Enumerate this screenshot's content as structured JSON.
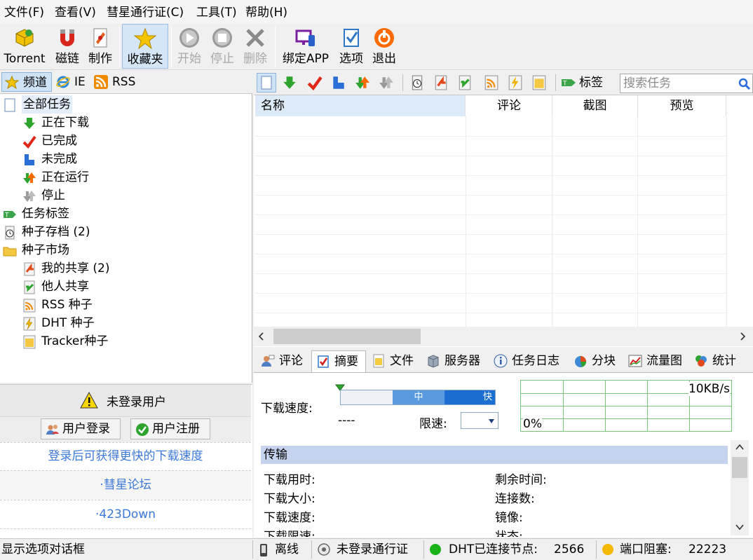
{
  "menubar": {
    "items": [
      "文件(F)",
      "查看(V)",
      "彗星通行证(C)",
      "工具(T)",
      "帮助(H)"
    ]
  },
  "toolbar": {
    "torrent": "Torrent",
    "magnet": "磁链",
    "create": "制作",
    "favorites": "收藏夹",
    "start": "开始",
    "stop": "停止",
    "delete": "删除",
    "bind_app": "绑定APP",
    "options": "选项",
    "exit": "退出"
  },
  "left_tabs": [
    "频道",
    "IE",
    "RSS"
  ],
  "tree": {
    "all_tasks": "全部任务",
    "downloading": "正在下载",
    "completed": "已完成",
    "incomplete": "未完成",
    "running": "正在运行",
    "stopped": "停止",
    "task_tags": "任务标签",
    "torrent_archive": "种子存档 (2)",
    "torrent_market": "种子市场",
    "my_shares": "我的共享 (2)",
    "others_shares": "他人共享",
    "rss_torrents": "RSS 种子",
    "dht_torrents": "DHT 种子",
    "tracker_torrents": "Tracker种子"
  },
  "user_panel": {
    "title": "未登录用户",
    "login": "用户登录",
    "register": "用户注册",
    "hint": "登录后可获得更快的下载速度",
    "link1": "·彗星论坛",
    "link2": "·423Down"
  },
  "task_toolbar": {
    "tags_label": "标签",
    "search_placeholder": "搜索任务"
  },
  "task_list": {
    "columns": [
      "名称",
      "评论",
      "截图",
      "预览"
    ]
  },
  "bottom_tabs": [
    "评论",
    "摘要",
    "文件",
    "服务器",
    "任务日志",
    "分块",
    "流量图",
    "统计"
  ],
  "summary": {
    "download_speed_label": "下载速度:",
    "speed_value": "----",
    "slider_mid": "中",
    "slider_fast": "快",
    "limit_label": "限速:",
    "graph_max": "10KB/s",
    "graph_pct": "0%",
    "section_title": "传输",
    "fields_left": [
      "下载用时:",
      "下载大小:",
      "下载速度:",
      "下载限速:"
    ],
    "fields_right": [
      "剩余时间:",
      "连接数:",
      "镜像:",
      "状态:"
    ]
  },
  "statusbar": {
    "message": "显示选项对话框",
    "offline": "离线",
    "pass": "未登录通行证",
    "dht_label": "DHT已连接节点:",
    "dht_nodes": "2566",
    "port_label": "端口阻塞:",
    "port": "22223"
  },
  "colors": {
    "accent_blue": "#1c6fd1",
    "selection": "#cfe3f7",
    "section_bar": "#c5d3ef",
    "graph_grid": "#7cc47c"
  }
}
